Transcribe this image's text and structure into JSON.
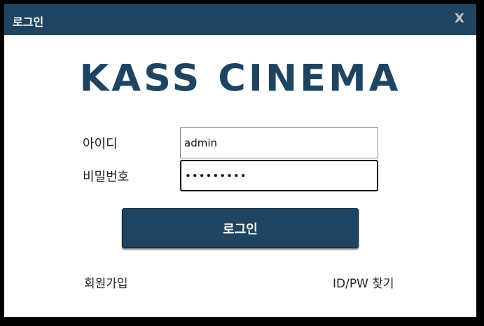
{
  "window": {
    "title": "로그인",
    "close_label": "X"
  },
  "logo": {
    "text": "KASS CINEMA"
  },
  "form": {
    "id_label": "아이디",
    "id_value": "admin",
    "pw_label": "비밀번호",
    "pw_value": "123456789",
    "login_label": "로그인"
  },
  "links": {
    "signup": "회원가입",
    "find": "ID/PW 찾기"
  },
  "colors": {
    "brand": "#1e4461",
    "background": "#ffffff",
    "text": "#222222"
  }
}
